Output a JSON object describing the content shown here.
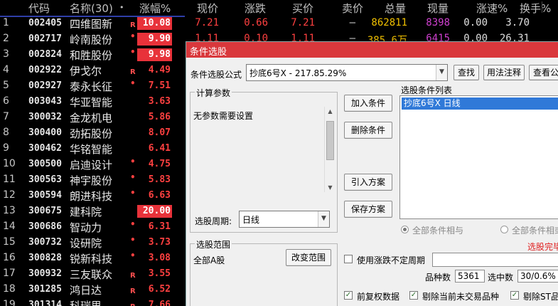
{
  "header": {
    "code": "代码",
    "name": "名称(30)",
    "dot": "•",
    "pct": "涨幅%",
    "price": "现价",
    "change": "涨跌",
    "bid": "买价",
    "ask": "卖价",
    "volume": "总量",
    "current": "现量",
    "speed": "涨速%",
    "turnover": "换手%"
  },
  "rows": [
    {
      "idx": "1",
      "code": "002405",
      "name": "四维图新",
      "flag": "R",
      "pct": "10.08",
      "box": true,
      "price": "7.21",
      "change": "0.66",
      "bid": "7.21",
      "ask": "—",
      "volume": "862811",
      "current": "8398",
      "speed": "0.00",
      "turnover": "3.70"
    },
    {
      "idx": "2",
      "code": "002717",
      "name": "岭南股份",
      "flag": "•",
      "pct": "9.90",
      "box": true,
      "price": "1.11",
      "change": "0.10",
      "bid": "1.11",
      "ask": "—",
      "volume": "385.6万",
      "current": "6415",
      "speed": "0.00",
      "turnover": "26.31"
    },
    {
      "idx": "3",
      "code": "002824",
      "name": "和胜股份",
      "flag": "•",
      "pct": "9.98",
      "box": true
    },
    {
      "idx": "4",
      "code": "002922",
      "name": "伊戈尔",
      "flag": "R",
      "pct": "4.49",
      "box": false
    },
    {
      "idx": "5",
      "code": "002927",
      "name": "泰永长征",
      "flag": "•",
      "pct": "7.51",
      "box": false
    },
    {
      "idx": "6",
      "code": "003043",
      "name": "华亚智能",
      "flag": "",
      "pct": "3.63",
      "box": false
    },
    {
      "idx": "7",
      "code": "300032",
      "name": "金龙机电",
      "flag": "",
      "pct": "5.86",
      "box": false
    },
    {
      "idx": "8",
      "code": "300400",
      "name": "劲拓股份",
      "flag": "",
      "pct": "8.07",
      "box": false
    },
    {
      "idx": "9",
      "code": "300462",
      "name": "华铭智能",
      "flag": "",
      "pct": "6.41",
      "box": false
    },
    {
      "idx": "10",
      "code": "300500",
      "name": "启迪设计",
      "flag": "•",
      "pct": "4.75",
      "box": false
    },
    {
      "idx": "11",
      "code": "300563",
      "name": "神宇股份",
      "flag": "•",
      "pct": "5.83",
      "box": false
    },
    {
      "idx": "12",
      "code": "300594",
      "name": "朗进科技",
      "flag": "•",
      "pct": "6.63",
      "box": false
    },
    {
      "idx": "13",
      "code": "300675",
      "name": "建科院",
      "flag": "",
      "pct": "20.00",
      "box": true
    },
    {
      "idx": "14",
      "code": "300686",
      "name": "智动力",
      "flag": "•",
      "pct": "6.31",
      "box": false
    },
    {
      "idx": "15",
      "code": "300732",
      "name": "设研院",
      "flag": "•",
      "pct": "3.73",
      "box": false
    },
    {
      "idx": "16",
      "code": "300828",
      "name": "锐新科技",
      "flag": "•",
      "pct": "3.08",
      "box": false
    },
    {
      "idx": "17",
      "code": "300932",
      "name": "三友联众",
      "flag": "R",
      "pct": "3.55",
      "box": false
    },
    {
      "idx": "18",
      "code": "301285",
      "name": "鸿日达",
      "flag": "R",
      "pct": "6.52",
      "box": false
    },
    {
      "idx": "19",
      "code": "301314",
      "name": "科瑞思",
      "flag": "R",
      "pct": "7.66",
      "box": false
    }
  ],
  "dialog": {
    "title": "条件选股",
    "formula_label": "条件选股公式",
    "formula_value": "抄底6号X  -  217.85.29%",
    "find_btn": "查找",
    "usage_btn": "用法注释",
    "view_btn": "查看公式",
    "params_group": "计算参数",
    "params_text": "无参数需要设置",
    "period_label": "选股周期:",
    "period_value": "日线",
    "add_btn": "加入条件",
    "delete_btn": "删除条件",
    "import_btn": "引入方案",
    "save_btn": "保存方案",
    "cond_list_label": "选股条件列表",
    "cond_item": "抄底6号X  日线",
    "radio_and": "全部条件相与",
    "radio_or": "全部条件相或",
    "done_text": "选股完毕",
    "range_group": "选股范围",
    "range_value": "全部A股",
    "change_range_btn": "改变范围",
    "uncertain_label": "使用涨跌不定周期",
    "count_label": "品种数",
    "count_value": "5361",
    "selected_label": "选中数",
    "selected_value": "30/0.6%",
    "chk_fuquan": "前复权数据",
    "chk_remove_notrade": "剔除当前未交易品种",
    "chk_remove_st": "剔除ST品种"
  },
  "colors": {
    "up": "#ff4040",
    "box": "#e8323a",
    "title": "#d9383c",
    "select": "#3079d8",
    "volume": "#f0c000",
    "current": "#d040d0"
  }
}
